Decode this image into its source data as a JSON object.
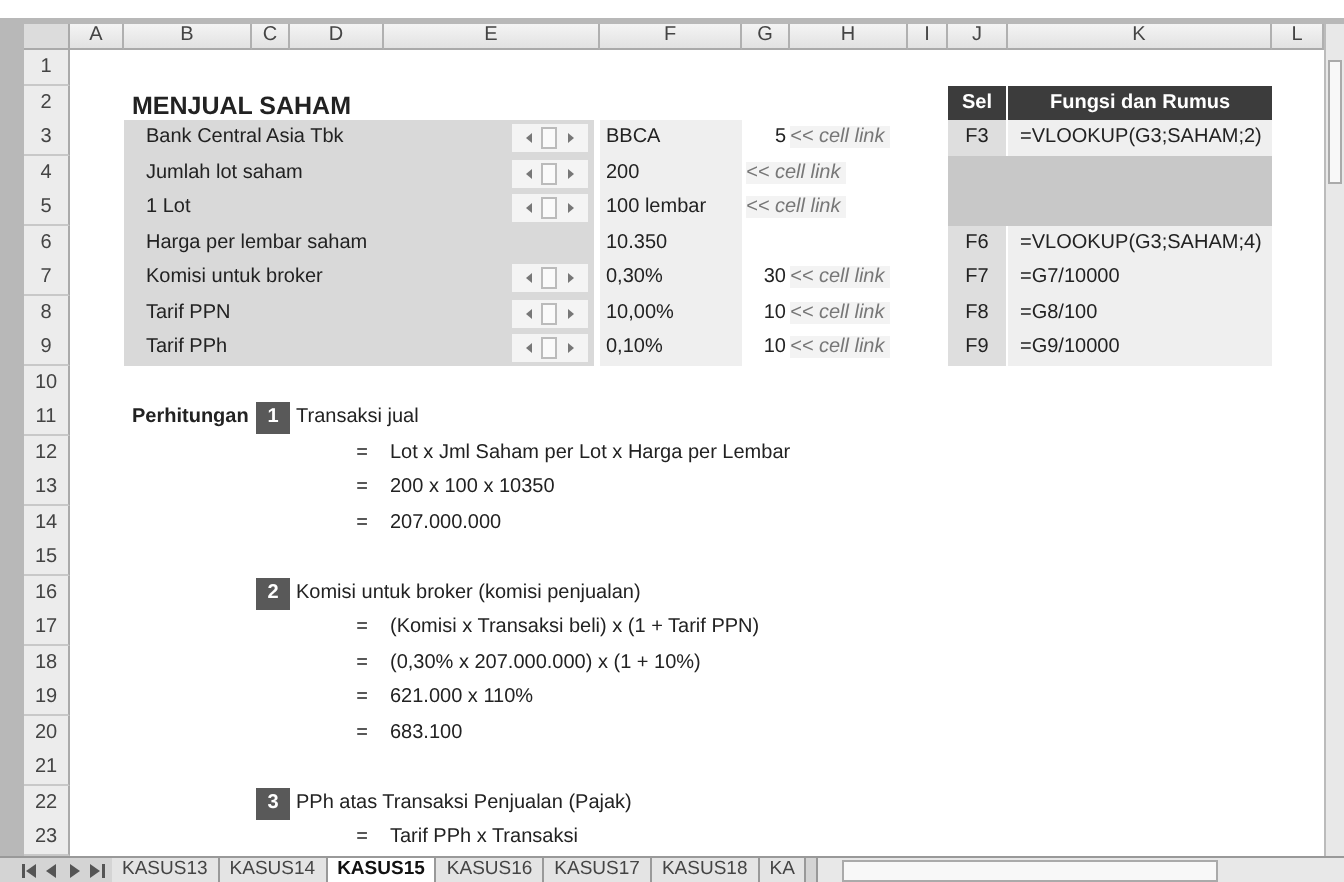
{
  "columns": [
    "A",
    "B",
    "C",
    "D",
    "E",
    "F",
    "G",
    "H",
    "I",
    "J",
    "K",
    "L"
  ],
  "row_numbers": [
    "1",
    "2",
    "3",
    "4",
    "5",
    "6",
    "7",
    "8",
    "9",
    "10",
    "11",
    "12",
    "13",
    "14",
    "15",
    "16",
    "17",
    "18",
    "19",
    "20",
    "21",
    "22",
    "23"
  ],
  "title": "MENJUAL SAHAM",
  "formula_header": {
    "cell": "Sel",
    "formula": "Fungsi dan Rumus"
  },
  "inputs": [
    {
      "label": "Bank Central Asia Tbk",
      "spinner": true,
      "value": "BBCA",
      "link_value": "5",
      "link_note": "<< cell link",
      "formula_cell": "F3",
      "formula": "=VLOOKUP(G3;SAHAM;2)"
    },
    {
      "label": "Jumlah lot saham",
      "spinner": true,
      "value": "200",
      "link_note": "<< cell link"
    },
    {
      "label": "1 Lot",
      "spinner": true,
      "value": "100 lembar",
      "link_note": "<< cell link"
    },
    {
      "label": "Harga per lembar saham",
      "spinner": false,
      "value": "10.350",
      "formula_cell": "F6",
      "formula": "=VLOOKUP(G3;SAHAM;4)"
    },
    {
      "label": "Komisi untuk broker",
      "spinner": true,
      "value": "0,30%",
      "link_value": "30",
      "link_note": "<< cell link",
      "formula_cell": "F7",
      "formula": "=G7/10000"
    },
    {
      "label": "Tarif PPN",
      "spinner": true,
      "value": "10,00%",
      "link_value": "10",
      "link_note": "<< cell link",
      "formula_cell": "F8",
      "formula": "=G8/100"
    },
    {
      "label": "Tarif PPh",
      "spinner": true,
      "value": "0,10%",
      "link_value": "10",
      "link_note": "<< cell link",
      "formula_cell": "F9",
      "formula": "=G9/10000"
    }
  ],
  "calc_label": "Perhitungan",
  "sections": [
    {
      "number": "1",
      "title": "Transaksi jual",
      "lines": [
        {
          "op": "=",
          "expr": "Lot x Jml Saham per Lot x Harga per Lembar"
        },
        {
          "op": "=",
          "expr": "200 x 100 x 10350"
        },
        {
          "op": "=",
          "expr": "207.000.000"
        }
      ]
    },
    {
      "number": "2",
      "title": "Komisi untuk broker (komisi penjualan)",
      "lines": [
        {
          "op": "=",
          "expr": "(Komisi x Transaksi beli) x (1 + Tarif PPN)"
        },
        {
          "op": "=",
          "expr": "(0,30% x 207.000.000) x (1 + 10%)"
        },
        {
          "op": "=",
          "expr": "621.000 x 110%"
        },
        {
          "op": "=",
          "expr": "683.100"
        }
      ]
    },
    {
      "number": "3",
      "title": "PPh atas Transaksi Penjualan (Pajak)",
      "lines": [
        {
          "op": "=",
          "expr": "Tarif PPh x Transaksi"
        }
      ]
    }
  ],
  "sheet_tabs": [
    {
      "label": "KASUS13",
      "selected": false
    },
    {
      "label": "KASUS14",
      "selected": false
    },
    {
      "label": "KASUS15",
      "selected": true
    },
    {
      "label": "KASUS16",
      "selected": false
    },
    {
      "label": "KASUS17",
      "selected": false
    },
    {
      "label": "KASUS18",
      "selected": false
    },
    {
      "label": "KA",
      "selected": false
    }
  ]
}
